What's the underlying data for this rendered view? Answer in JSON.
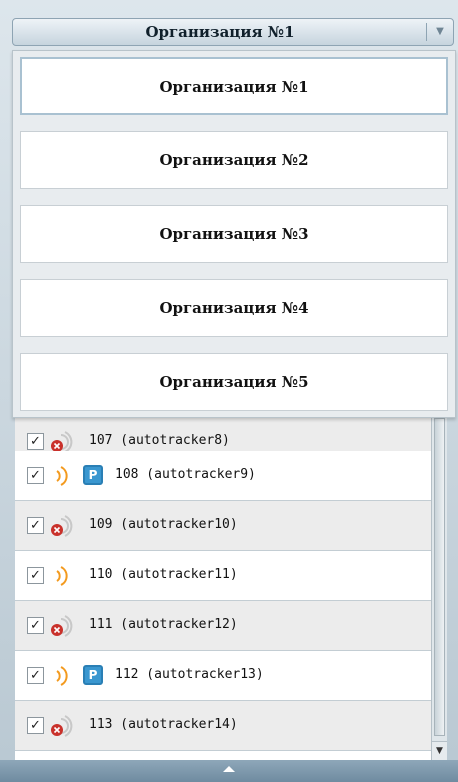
{
  "combobox": {
    "selected": "Организация №1"
  },
  "dropdown": {
    "options": [
      "Организация №1",
      "Организация №2",
      "Организация №3",
      "Организация №4",
      "Организация №5"
    ]
  },
  "list": {
    "rows": [
      {
        "label": "107 (autotracker8)",
        "status": "offline"
      },
      {
        "label": "108 (autotracker9)",
        "status": "online",
        "badge": "P"
      },
      {
        "label": "109 (autotracker10)",
        "status": "offline"
      },
      {
        "label": "110 (autotracker11)",
        "status": "online"
      },
      {
        "label": "111 (autotracker12)",
        "status": "offline"
      },
      {
        "label": "112 (autotracker13)",
        "status": "online",
        "badge": "P"
      },
      {
        "label": "113 (autotracker14)",
        "status": "offline"
      }
    ]
  },
  "colors": {
    "online_signal": "#f39a1e",
    "offline_signal": "#c8c8c8",
    "offline_badge": "#c9312b",
    "parking_badge": "#3a97d0"
  },
  "icons": {
    "dropdown": "chevron-down-icon",
    "online": "signal-icon",
    "offline": "signal-off-icon",
    "parking": "parking-icon",
    "scroll_up": "chevron-up-icon"
  }
}
